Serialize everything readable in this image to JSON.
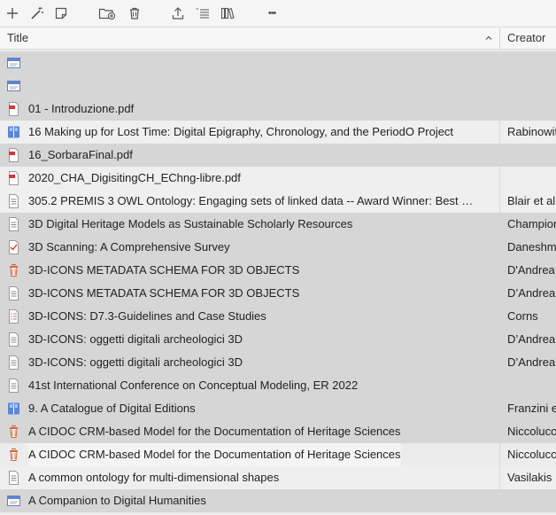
{
  "toolbar": {
    "buttons": [
      {
        "name": "new-item-button",
        "icon": "plus-icon"
      },
      {
        "name": "magic-add-button",
        "icon": "wand-icon"
      },
      {
        "name": "new-note-button",
        "icon": "note-icon"
      },
      {
        "name": "new-collection-button",
        "icon": "folder-plus-icon"
      },
      {
        "name": "trash-button",
        "icon": "trash-icon"
      },
      {
        "name": "export-button",
        "icon": "upload-icon"
      },
      {
        "name": "citation-button",
        "icon": "quote-list-icon"
      },
      {
        "name": "library-button",
        "icon": "books-icon"
      },
      {
        "name": "more-button",
        "icon": "ellipsis-icon",
        "label": "•••"
      }
    ]
  },
  "columns": {
    "title": "Title",
    "creator": "Creator"
  },
  "rows": [
    {
      "icon": "web",
      "title": "",
      "creator": "",
      "style": "sel"
    },
    {
      "icon": "web",
      "title": "",
      "creator": "",
      "style": "sel"
    },
    {
      "icon": "pdf",
      "title": "01 - Introduzione.pdf",
      "creator": "",
      "style": "sel"
    },
    {
      "icon": "book",
      "title": "16 Making up for Lost Time: Digital Epigraphy, Chronology, and the PeriodO Project",
      "creator": "Rabinowitz",
      "style": "alt"
    },
    {
      "icon": "pdf",
      "title": "16_SorbaraFinal.pdf",
      "creator": "",
      "style": "sel"
    },
    {
      "icon": "pdf",
      "title": "2020_CHA_DigisitingCH_EChng-libre.pdf",
      "creator": "",
      "style": "alt"
    },
    {
      "icon": "doc",
      "title": "305.2 PREMIS 3 OWL Ontology: Engaging sets of linked data -- Award Winner: Best …",
      "creator": "Blair et al.",
      "style": "alt"
    },
    {
      "icon": "doc",
      "title": "3D Digital Heritage Models as Sustainable Scholarly Resources",
      "creator": "Champion",
      "style": "sel"
    },
    {
      "icon": "check",
      "title": "3D Scanning: A Comprehensive Survey",
      "creator": "Daneshmand",
      "style": "sel"
    },
    {
      "icon": "map",
      "title": "3D-ICONS METADATA SCHEMA FOR 3D OBJECTS",
      "creator": "D'Andrea",
      "style": "sel"
    },
    {
      "icon": "doc",
      "title": "3D-ICONS METADATA SCHEMA FOR 3D OBJECTS",
      "creator": "D’Andrea",
      "style": "sel"
    },
    {
      "icon": "report",
      "title": "3D-ICONS: D7.3-Guidelines and Case Studies",
      "creator": "Corns",
      "style": "sel"
    },
    {
      "icon": "doc",
      "title": "3D-ICONS: oggetti digitali archeologici 3D",
      "creator": "D’Andrea",
      "style": "sel"
    },
    {
      "icon": "doc",
      "title": "3D-ICONS: oggetti digitali archeologici 3D",
      "creator": "D’Andrea",
      "style": "sel"
    },
    {
      "icon": "doc",
      "title": "41st International Conference on Conceptual Modeling, ER 2022",
      "creator": "",
      "style": "sel"
    },
    {
      "icon": "book",
      "title": "9. A Catalogue of Digital Editions",
      "creator": "Franzini et",
      "style": "sel"
    },
    {
      "icon": "map",
      "title": "A CIDOC CRM-based Model for the Documentation of Heritage Sciences",
      "creator": "Niccolucci",
      "style": "sel"
    },
    {
      "icon": "map",
      "title": "A CIDOC CRM-based Model for the Documentation of Heritage Sciences",
      "creator": "Niccolucci",
      "style": "hl"
    },
    {
      "icon": "doc",
      "title": "A common ontology for multi-dimensional shapes",
      "creator": "Vasilakis",
      "style": "alt"
    },
    {
      "icon": "web",
      "title": "A Companion to Digital Humanities",
      "creator": "",
      "style": "sel"
    }
  ]
}
